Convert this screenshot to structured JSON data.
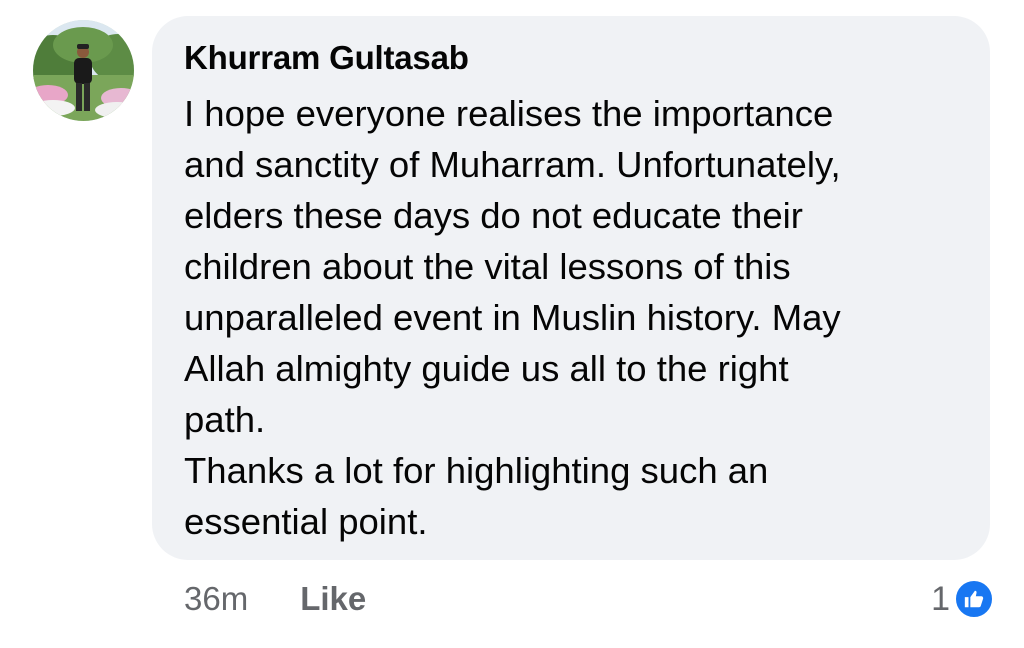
{
  "comment": {
    "author": "Khurram Gultasab",
    "avatar_icon": "user-avatar-photo",
    "paragraphs": [
      "I hope everyone realises the importance and sanctity of Muharram. Unfortunately, elders these days do not educate their children about the vital lessons of this unparalleled event in Muslin history. May Allah almighty guide us all to the right path.",
      "Thanks a lot for highlighting such an essential point."
    ],
    "lines": [
      "I hope everyone realises the importance",
      "and sanctity of Muharram. Unfortunately,",
      "elders these days do not educate their",
      "children about the vital lessons of this",
      "unparalleled event in Muslin history. May",
      "Allah almighty guide us all to the right",
      "path.",
      "Thanks a lot for highlighting such an",
      "essential point."
    ],
    "bubble_color": "#f0f2f5"
  },
  "actions": {
    "time": "36m",
    "like_label": "Like"
  },
  "reactions": {
    "count": "1",
    "icon": "thumbs-up-icon",
    "badge_color": "#1877f2"
  }
}
